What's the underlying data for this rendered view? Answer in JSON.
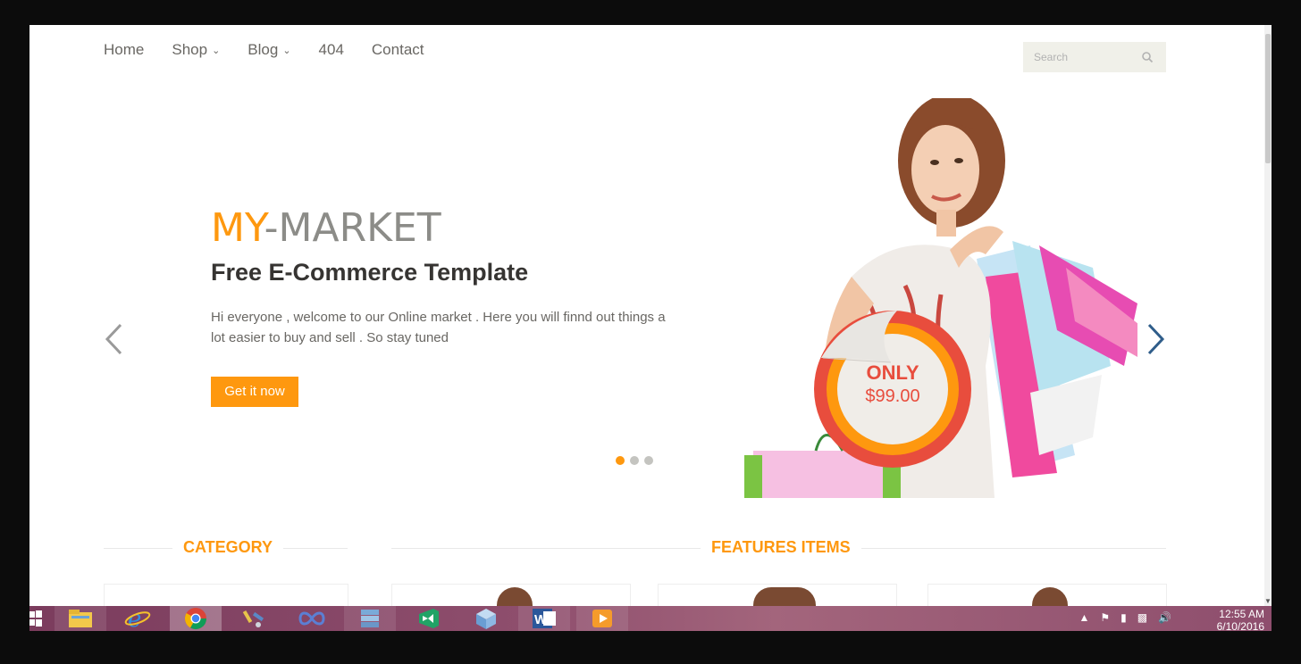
{
  "nav": {
    "items": [
      {
        "label": "Home",
        "dropdown": false
      },
      {
        "label": "Shop",
        "dropdown": true
      },
      {
        "label": "Blog",
        "dropdown": true
      },
      {
        "label": "404",
        "dropdown": false
      },
      {
        "label": "Contact",
        "dropdown": false
      }
    ],
    "search_placeholder": "Search"
  },
  "hero": {
    "brand_my": "MY",
    "brand_rest": "-MARKET",
    "headline": "Free E-Commerce Template",
    "description": "Hi everyone , welcome to our Online market . Here you will finnd out things a lot easier to buy and sell . So stay tuned",
    "cta_label": "Get it now",
    "price_only": "ONLY",
    "price_value": "$99.00",
    "slides_total": 3,
    "active_slide": 1
  },
  "sections": {
    "category_title": "CATEGORY",
    "features_title": "FEATURES ITEMS"
  },
  "taskbar": {
    "apps": [
      "file-explorer-icon",
      "internet-explorer-icon",
      "chrome-icon",
      "tools-icon",
      "infinity-icon",
      "stack-icon",
      "visual-studio-icon",
      "cube-icon",
      "word-icon",
      "media-player-icon"
    ],
    "active_app": "chrome-icon",
    "time": "12:55 AM",
    "date": "6/10/2016"
  },
  "colors": {
    "accent": "#fe980f",
    "heading": "#363432",
    "text": "#696763",
    "badge_red": "#e84d3d",
    "slider_arrow_right": "#2f5d8a"
  }
}
